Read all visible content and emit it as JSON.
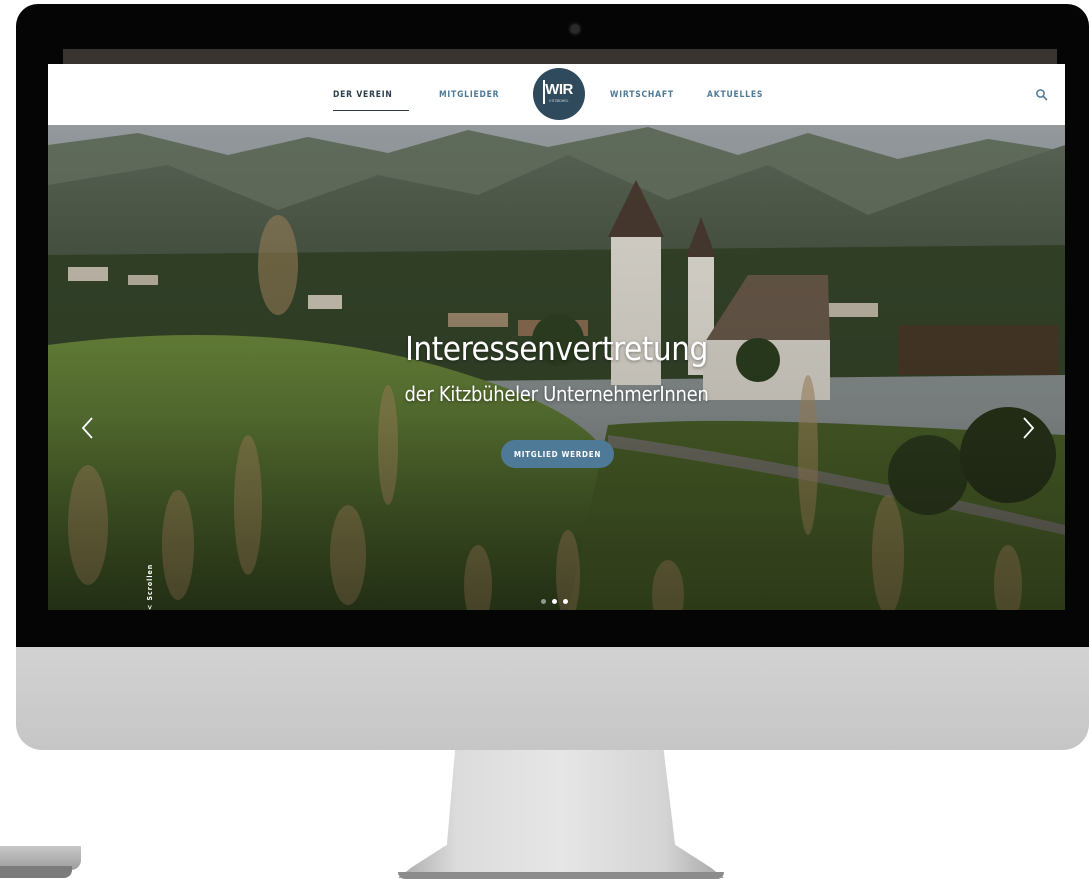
{
  "nav": {
    "items": [
      {
        "label": "DER VEREIN",
        "active": true
      },
      {
        "label": "MITGLIEDER",
        "active": false
      },
      {
        "label": "WIRTSCHAFT",
        "active": false
      },
      {
        "label": "AKTUELLES",
        "active": false
      }
    ],
    "logo": {
      "text": "WIR",
      "subtext": "KITZBÜHEL"
    },
    "search_icon": "search-icon"
  },
  "hero": {
    "title": "Interessenvertretung",
    "subtitle": "der Kitzbüheler UnternehmerInnen",
    "cta_label": "MITGLIED WERDEN",
    "scroll_label": "< Scrollen",
    "prev_icon": "chevron-left-icon",
    "next_icon": "chevron-right-icon",
    "slides_total": 3,
    "slide_active": 2
  },
  "colors": {
    "accent": "#4e7997",
    "logo_bg": "#2f4a5c",
    "nav_active": "#2c3e4c"
  }
}
